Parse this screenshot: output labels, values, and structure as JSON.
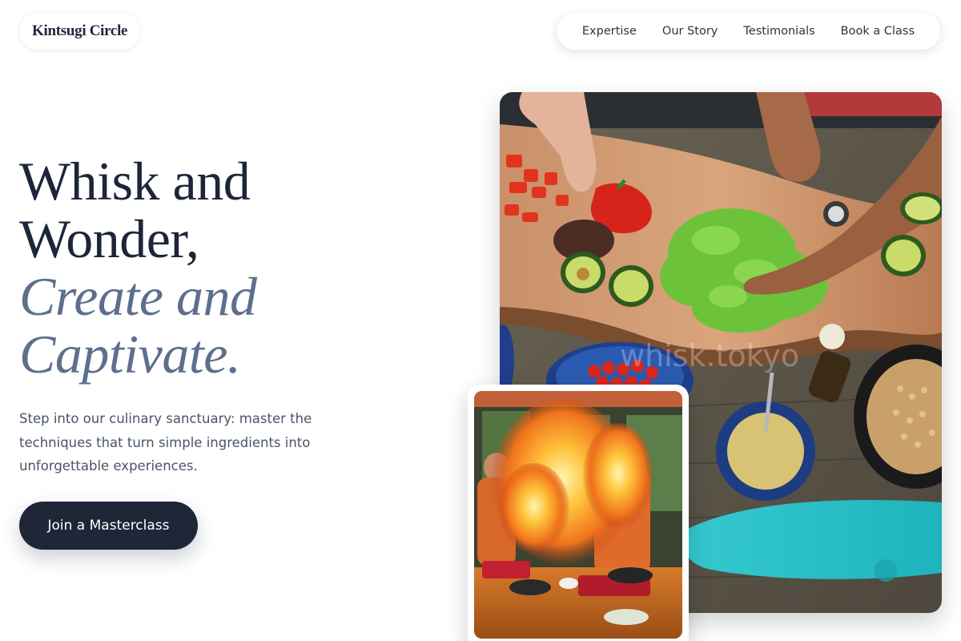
{
  "brand": {
    "name": "Kintsugi Circle"
  },
  "nav": {
    "items": [
      {
        "label": "Expertise"
      },
      {
        "label": "Our Story"
      },
      {
        "label": "Testimonials"
      },
      {
        "label": "Book a Class"
      }
    ]
  },
  "hero": {
    "headline_line1": "Whisk and",
    "headline_line2": "Wonder,",
    "headline_line3": "Create and",
    "headline_line4": "Captivate.",
    "description": "Step into our culinary sanctuary: master the techniques that turn simple ingredients into unforgettable experiences.",
    "cta_label": "Join a Masterclass"
  },
  "images": {
    "main_watermark": "whisk.tokyo"
  }
}
